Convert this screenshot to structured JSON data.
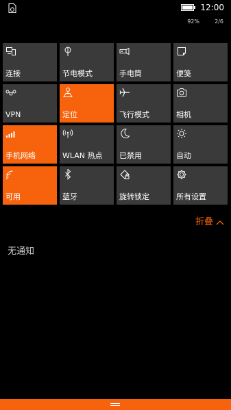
{
  "status": {
    "time": "12:00",
    "battery": "92%",
    "page": "2/6"
  },
  "tiles": [
    {
      "id": "connect",
      "label": "连接",
      "icon": "connect-icon",
      "on": false
    },
    {
      "id": "battery-saver",
      "label": "节电模式",
      "icon": "battery-saver-icon",
      "on": false
    },
    {
      "id": "flashlight",
      "label": "手电筒",
      "icon": "flashlight-icon",
      "on": false
    },
    {
      "id": "note",
      "label": "便笺",
      "icon": "note-icon",
      "on": false
    },
    {
      "id": "vpn",
      "label": "VPN",
      "icon": "vpn-icon",
      "on": false
    },
    {
      "id": "location",
      "label": "定位",
      "icon": "location-icon",
      "on": true
    },
    {
      "id": "airplane",
      "label": "飞行模式",
      "icon": "airplane-icon",
      "on": false
    },
    {
      "id": "camera",
      "label": "相机",
      "icon": "camera-icon",
      "on": false
    },
    {
      "id": "cellular",
      "label": "手机网络",
      "icon": "cellular-signal-icon",
      "on": true
    },
    {
      "id": "hotspot",
      "label": "WLAN 热点",
      "icon": "hotspot-icon",
      "on": false
    },
    {
      "id": "quiet",
      "label": "已禁用",
      "icon": "moon-icon",
      "on": false
    },
    {
      "id": "brightness",
      "label": "自动",
      "icon": "brightness-icon",
      "on": false
    },
    {
      "id": "wifi",
      "label": "可用",
      "icon": "wifi-icon",
      "on": true
    },
    {
      "id": "bluetooth",
      "label": "蓝牙",
      "icon": "bluetooth-icon",
      "on": false
    },
    {
      "id": "rotation",
      "label": "旋转锁定",
      "icon": "rotation-lock-icon",
      "on": false
    },
    {
      "id": "settings",
      "label": "所有设置",
      "icon": "gear-icon",
      "on": false
    }
  ],
  "collapse_label": "折叠",
  "no_notifications": "无通知",
  "colors": {
    "accent": "#f7630c",
    "tile": "#3a3a3a",
    "background": "#000000"
  }
}
